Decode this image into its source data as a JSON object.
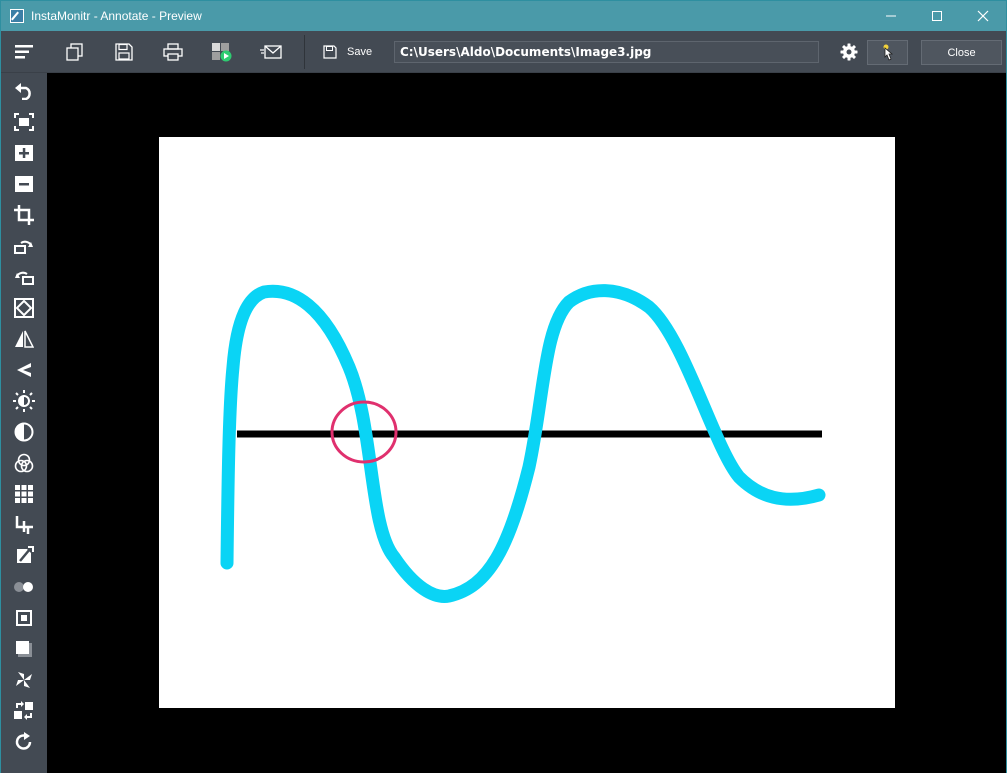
{
  "window": {
    "title": "InstaMonitr - Annotate - Preview",
    "title_bar_color": "#4a9aa9"
  },
  "window_controls": {
    "minimize_icon": "minimize-icon",
    "maximize_icon": "maximize-icon",
    "close_icon": "close-x-icon"
  },
  "toolbar": {
    "menu_icon": "hamburger-menu-icon",
    "copy_icon": "copy-icon",
    "save_icon": "floppy-disk-icon",
    "print_icon": "printer-icon",
    "share_icon": "share-app-icon",
    "email_icon": "envelope-icon",
    "save_label": "Save",
    "file_path": "C:\\Users\\Aldo\\Documents\\Image3.jpg",
    "settings_icon": "gear-icon",
    "pointer_icon": "cursor-pointer-icon",
    "close_label": "Close",
    "background": "#434a53"
  },
  "sidebar": {
    "tools": [
      {
        "name": "undo",
        "icon": "undo-icon"
      },
      {
        "name": "fit-to-window",
        "icon": "fit-screen-icon"
      },
      {
        "name": "zoom-in",
        "icon": "zoom-in-icon"
      },
      {
        "name": "zoom-out",
        "icon": "zoom-out-icon"
      },
      {
        "name": "crop",
        "icon": "crop-icon"
      },
      {
        "name": "rotate-right",
        "icon": "rotate-right-icon"
      },
      {
        "name": "rotate-left",
        "icon": "rotate-left-icon"
      },
      {
        "name": "free-rotate",
        "icon": "free-rotate-icon"
      },
      {
        "name": "flip-horizontal",
        "icon": "flip-horizontal-icon"
      },
      {
        "name": "flip-vertical",
        "icon": "flip-vertical-icon"
      },
      {
        "name": "brightness",
        "icon": "brightness-icon"
      },
      {
        "name": "contrast",
        "icon": "contrast-icon"
      },
      {
        "name": "color-balance",
        "icon": "rgb-circles-icon"
      },
      {
        "name": "grid",
        "icon": "grid-icon"
      },
      {
        "name": "resize",
        "icon": "resize-icon"
      },
      {
        "name": "draw",
        "icon": "pen-icon"
      },
      {
        "name": "toggle",
        "icon": "toggle-icon"
      },
      {
        "name": "frame",
        "icon": "frame-icon"
      },
      {
        "name": "shadow",
        "icon": "shadow-icon"
      },
      {
        "name": "effects",
        "icon": "pinwheel-icon"
      },
      {
        "name": "swap",
        "icon": "swap-icon"
      },
      {
        "name": "reset",
        "icon": "refresh-icon"
      }
    ]
  },
  "annotations": {
    "wave_color": "#0ad4f5",
    "line_color": "#000000",
    "circle_color": "#e0306e"
  }
}
